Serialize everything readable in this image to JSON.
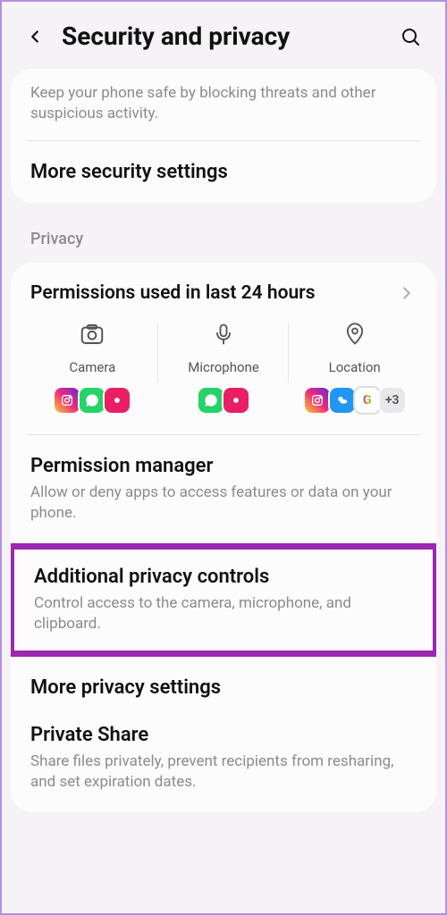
{
  "header": {
    "title": "Security and privacy"
  },
  "top_card": {
    "description": "Keep your phone safe by blocking threats and other suspicious activity.",
    "more_security": "More security settings"
  },
  "privacy": {
    "label": "Privacy",
    "permissions_used": "Permissions used in last 24 hours",
    "cols": {
      "camera": "Camera",
      "microphone": "Microphone",
      "location": "Location"
    },
    "more_badge": "+3",
    "google_g": "G",
    "permission_manager": {
      "title": "Permission manager",
      "sub": "Allow or deny apps to access features or data on your phone."
    },
    "additional": {
      "title": "Additional privacy controls",
      "sub": "Control access to the camera, microphone, and clipboard."
    },
    "more_privacy": "More privacy settings",
    "private_share": {
      "title": "Private Share",
      "sub": "Share files privately, prevent recipients from resharing, and set expiration dates."
    }
  }
}
